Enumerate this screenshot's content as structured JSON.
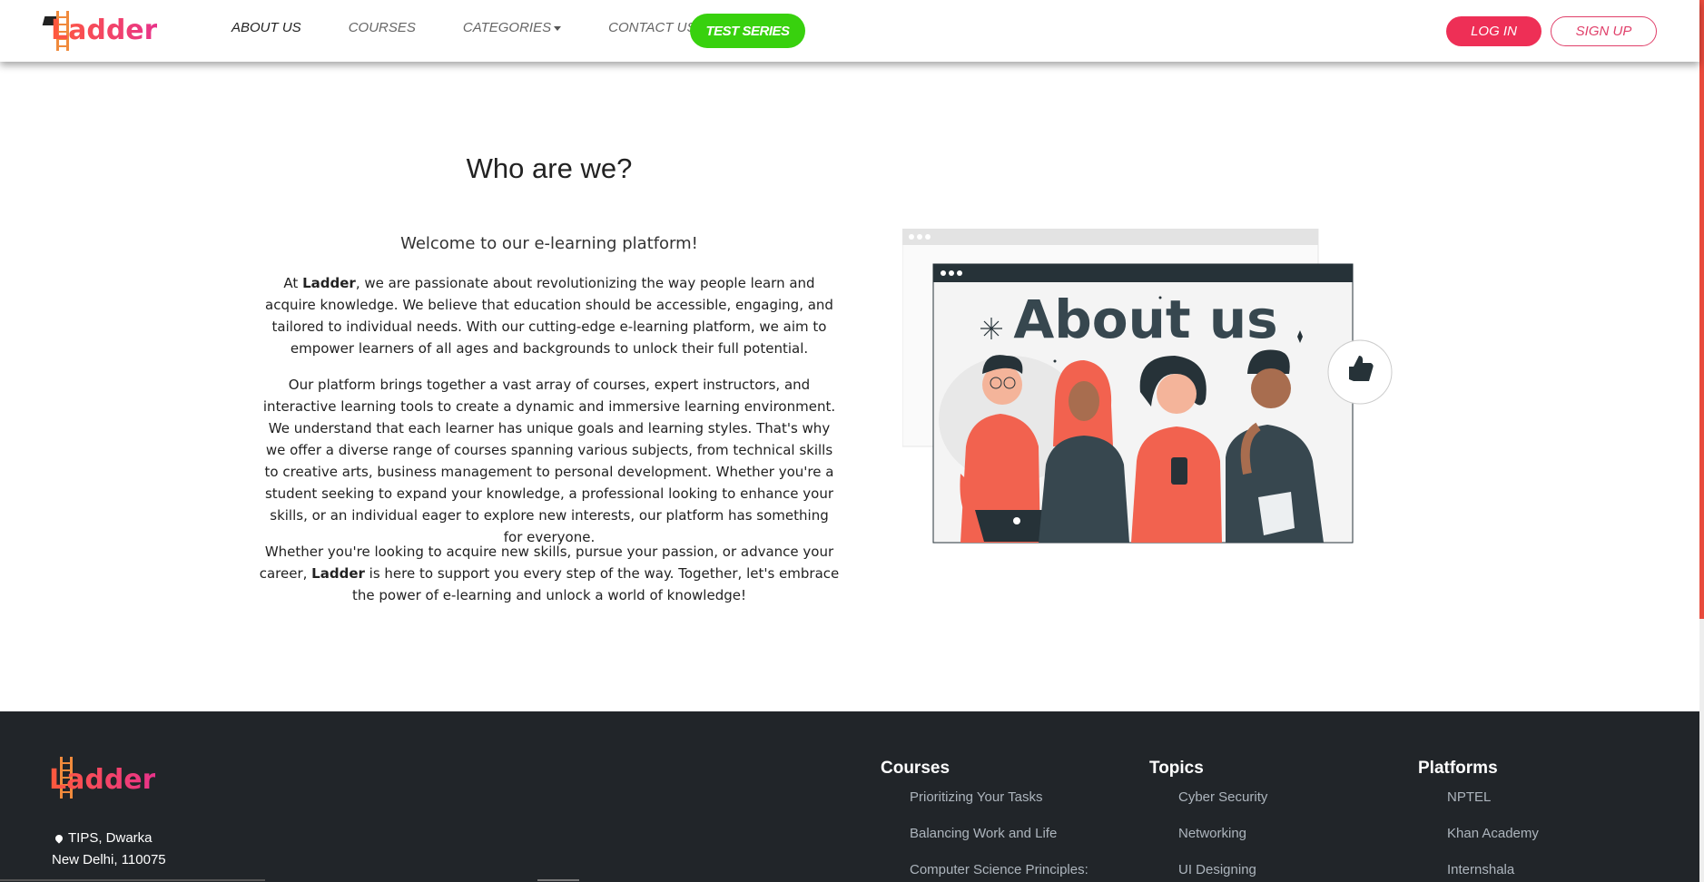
{
  "brand": {
    "name": "Ladder"
  },
  "nav": {
    "about": "ABOUT US",
    "courses": "COURSES",
    "categories": "CATEGORIES",
    "contact": "CONTACT US",
    "test_series": "TEST SERIES",
    "login": "LOG IN",
    "signup": "SIGN UP"
  },
  "main": {
    "title": "Who are we?",
    "welcome": "Welcome to our e-learning platform!",
    "p1_pre": "At ",
    "p1_brand": "Ladder",
    "p1_post": ", we are passionate about revolutionizing the way people learn and acquire knowledge. We believe that education should be accessible, engaging, and tailored to individual needs. With our cutting-edge e-learning platform, we aim to empower learners of all ages and backgrounds to unlock their full potential.",
    "p2": "Our platform brings together a vast array of courses, expert instructors, and interactive learning tools to create a dynamic and immersive learning environment. We understand that each learner has unique goals and learning styles. That's why we offer a diverse range of courses spanning various subjects, from technical skills to creative arts, business management to personal development. Whether you're a student seeking to expand your knowledge, a professional looking to enhance your skills, or an individual eager to explore new interests, our platform has something for everyone.",
    "p3_pre": "Whether you're looking to acquire new skills, pursue your passion, or advance your career, ",
    "p3_brand": "Ladder",
    "p3_post": " is here to support you every step of the way. Together, let's embrace the power of e-learning and unlock a world of knowledge!",
    "illustration_text": "About us"
  },
  "footer": {
    "address_line1": "TIPS, Dwarka",
    "address_line2": "New Delhi, 110075",
    "courses": {
      "heading": "Courses",
      "items": [
        "Prioritizing Your Tasks",
        "Balancing Work and Life",
        "Computer Science Principles:"
      ]
    },
    "topics": {
      "heading": "Topics",
      "items": [
        "Cyber Security",
        "Networking",
        "UI Designing"
      ]
    },
    "platforms": {
      "heading": "Platforms",
      "items": [
        "NPTEL",
        "Khan Academy",
        "Internshala"
      ]
    }
  },
  "colors": {
    "accent_red": "#ee2f56",
    "test_green": "#38d10e",
    "footer_bg": "#212529"
  }
}
